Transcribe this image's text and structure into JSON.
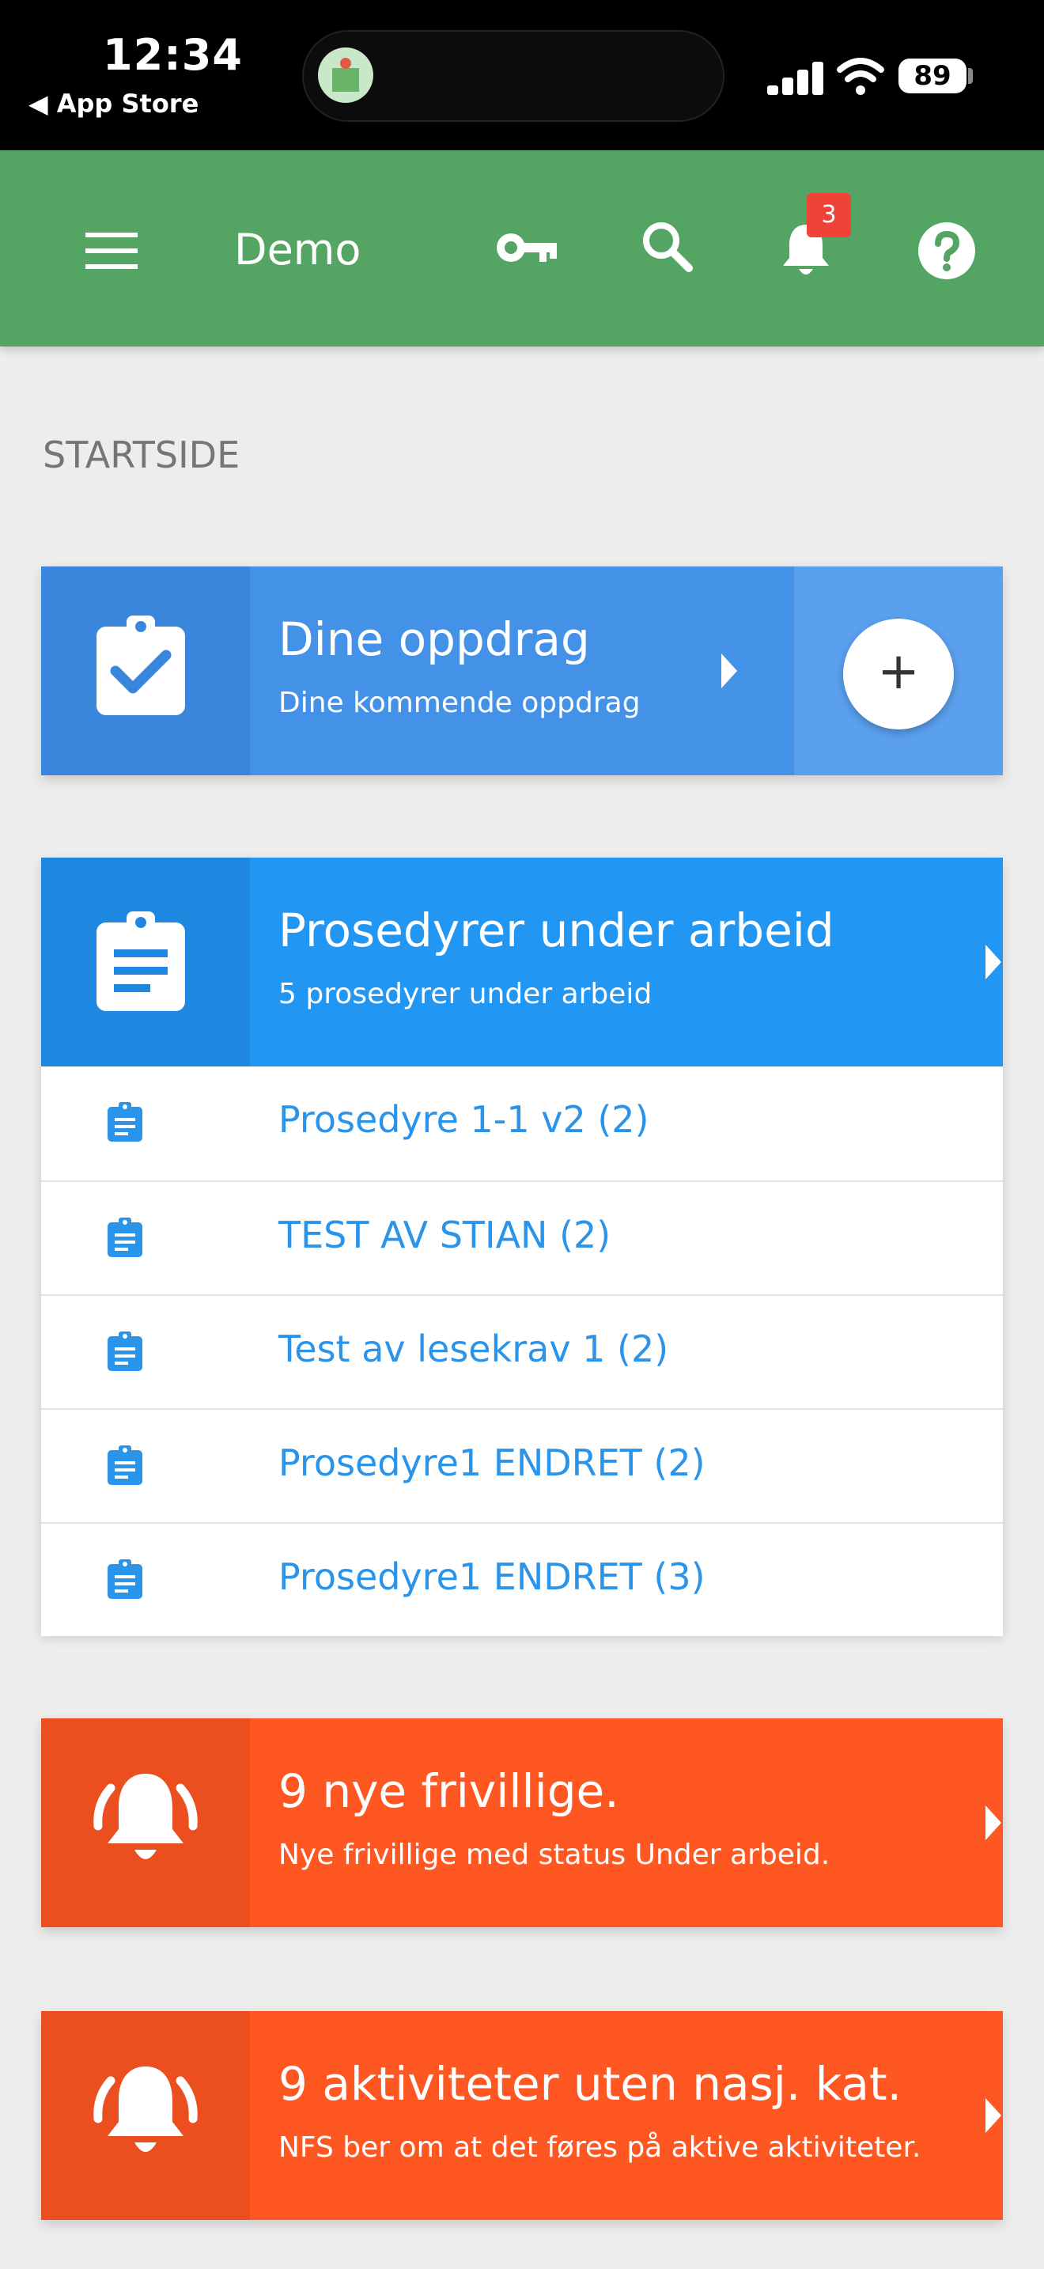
{
  "status_bar": {
    "time": "12:34",
    "back_label": "App Store",
    "battery": "89",
    "icons": [
      "signal-icon",
      "wifi-icon",
      "battery-icon"
    ]
  },
  "header": {
    "title": "Demo",
    "notification_count": "3",
    "background_color": "#54a564",
    "icons": [
      "menu-icon",
      "key-icon",
      "search-icon",
      "bell-icon",
      "help-icon"
    ]
  },
  "page_title": "STARTSIDE",
  "cards": {
    "assignments": {
      "title": "Dine oppdrag",
      "subtitle": "Dine kommende oppdrag",
      "add_label": "+",
      "color": "#4392e8"
    },
    "procedures": {
      "title": "Prosedyrer under arbeid",
      "subtitle": "5 prosedyrer under arbeid",
      "color": "#2196f3",
      "items": [
        "Prosedyre 1-1 v2 (2)",
        "TEST AV STIAN (2)",
        "Test av lesekrav 1 (2)",
        "Prosedyre1 ENDRET (2)",
        "Prosedyre1 ENDRET (3)"
      ]
    },
    "volunteers": {
      "title": "9 nye frivillige.",
      "subtitle": "Nye frivillige med status Under arbeid.",
      "color": "#ff5722"
    },
    "activities": {
      "title": "9 aktiviteter uten nasj. kat.",
      "subtitle": "NFS ber om at det føres på aktive aktiviteter.",
      "color": "#ff5722"
    }
  }
}
